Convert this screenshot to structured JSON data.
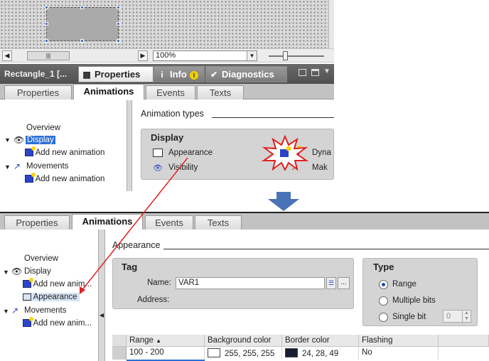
{
  "top": {
    "zoom_value": "100%",
    "window_title": "Rectangle_1 [...",
    "panel_tabs": [
      {
        "label": "Properties",
        "icon": "properties-icon"
      },
      {
        "label": "Info",
        "icon": "info-icon"
      },
      {
        "label": "Diagnostics",
        "icon": "diagnostics-icon"
      }
    ],
    "inspector_tabs": [
      "Properties",
      "Animations",
      "Events",
      "Texts"
    ],
    "tree": {
      "overview": "Overview",
      "display": "Display",
      "add_new_1": "Add new animation",
      "movements": "Movements",
      "add_new_2": "Add new animation"
    },
    "animation_types_heading": "Animation types",
    "display_group_title": "Display",
    "appearance": "Appearance",
    "visibility": "Visibility",
    "dyn_truncated": "Dyna",
    "mak_truncated": "Mak"
  },
  "bottom": {
    "inspector_tabs": [
      "Properties",
      "Animations",
      "Events",
      "Texts"
    ],
    "tree": {
      "overview": "Overview",
      "display": "Display",
      "add_new_1": "Add new anim...",
      "appearance": "Appearance",
      "movements": "Movements",
      "add_new_2": "Add new anim..."
    },
    "section_heading": "Appearance",
    "tag": {
      "title": "Tag",
      "name_label": "Name:",
      "name_value": "VAR1",
      "address_label": "Address:"
    },
    "type": {
      "title": "Type",
      "options": [
        "Range",
        "Multiple bits",
        "Single bit"
      ],
      "selected": "Range",
      "single_bit_value": "0"
    },
    "table": {
      "headers": [
        "Range",
        "Background color",
        "Border color",
        "Flashing"
      ],
      "rows": [
        {
          "range": "100 - 200",
          "background": "255, 255, 255",
          "border": "24, 28, 49",
          "flashing": "No",
          "bg_hex": "#ffffff",
          "border_hex": "#181c31"
        }
      ]
    }
  },
  "colors": {
    "arrow_blue": "#4a72b6",
    "annotation_red": "#e02020",
    "selection_blue": "#2b6fd6"
  }
}
